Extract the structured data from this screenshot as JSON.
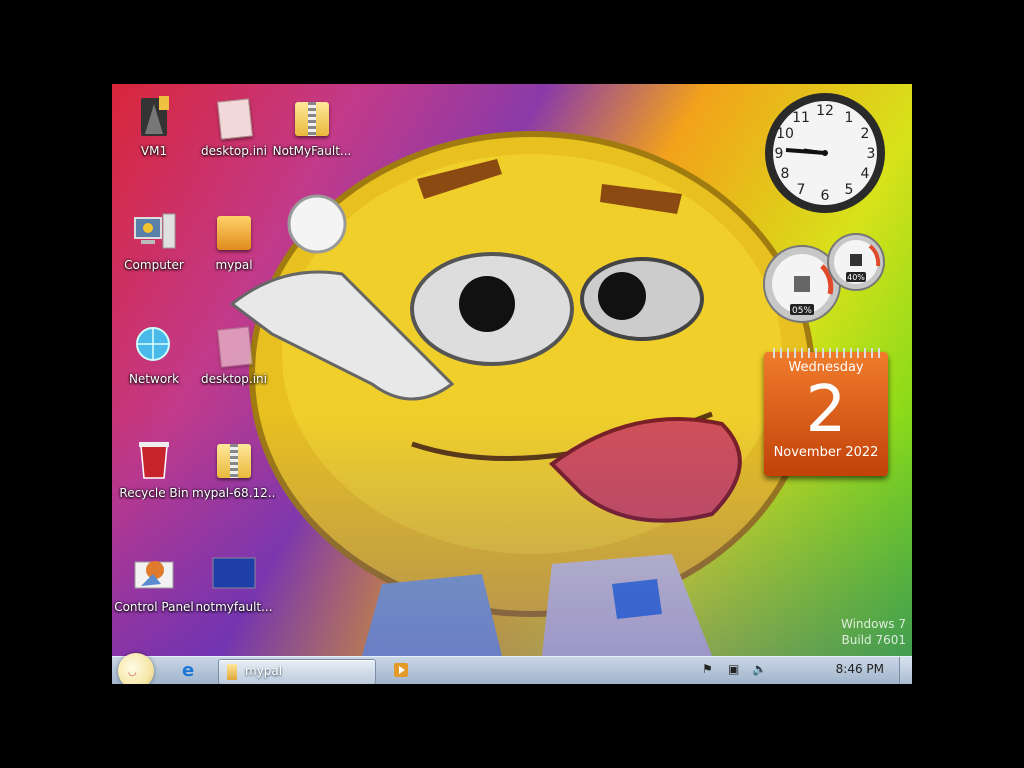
{
  "desktop": {
    "icons": [
      {
        "label": "VM1"
      },
      {
        "label": "desktop.ini"
      },
      {
        "label": "NotMyFault..."
      },
      {
        "label": "Computer"
      },
      {
        "label": "mypal"
      },
      {
        "label": "Network"
      },
      {
        "label": "desktop.ini"
      },
      {
        "label": "Recycle Bin"
      },
      {
        "label": "mypal-68.12..."
      },
      {
        "label": "Control Panel"
      },
      {
        "label": "notmyfault..."
      }
    ]
  },
  "gadgets": {
    "clock_time": "8:46",
    "cpu_meter": {
      "cpu": "05%",
      "memory": "40%"
    },
    "calendar": {
      "weekday": "Wednesday",
      "day": "2",
      "month_year": "November 2022"
    }
  },
  "watermark": {
    "line1": "Windows 7",
    "line2": "Build 7601"
  },
  "taskbar": {
    "task_label": "mypal",
    "clock": "8:46 PM"
  },
  "colors": {
    "taskbar": "#a9bbd0",
    "calendar": "#e0641c"
  }
}
